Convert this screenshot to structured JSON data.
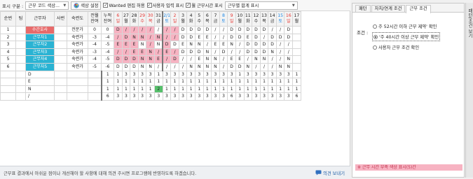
{
  "toolbar": {
    "display_label": "표시 구분 :",
    "display_value": "근무 코드 색상...",
    "color_btn": "색상 설정",
    "wanted_label": "Wanted 편집 허용",
    "user_label": "사용자 입력 표시",
    "monthly_label": "월 근무시간 표시",
    "sum_value": "근무별 합계 표시"
  },
  "grid": {
    "headers": [
      {
        "t": "순번"
      },
      {
        "t": "팀"
      },
      {
        "t": "근무자"
      },
      {
        "t": "사번"
      },
      {
        "t": "숙련도"
      },
      {
        "t": "전월 잔여"
      },
      {
        "t": "누적 잔여"
      },
      {
        "t": "6 일",
        "c": "red"
      },
      {
        "t": "27 월"
      },
      {
        "t": "28 화"
      },
      {
        "t": "29 수",
        "c": "red"
      },
      {
        "t": "30 목",
        "c": "red"
      },
      {
        "t": "31 금"
      },
      {
        "t": "2/1 토",
        "c": "blu"
      },
      {
        "t": "2 일",
        "c": "red"
      },
      {
        "t": "3 월"
      },
      {
        "t": "4 화"
      },
      {
        "t": "5 수"
      },
      {
        "t": "6 목"
      },
      {
        "t": "7 금"
      },
      {
        "t": "8 토",
        "c": "blu"
      },
      {
        "t": "9 일",
        "c": "red"
      },
      {
        "t": "10 월"
      },
      {
        "t": "11 화"
      },
      {
        "t": "12 수"
      },
      {
        "t": "13 목"
      },
      {
        "t": "14 금"
      },
      {
        "t": "15 토",
        "c": "blu"
      },
      {
        "t": "16 일",
        "c": "red"
      },
      {
        "t": "17 월"
      }
    ],
    "rows": [
      {
        "no": "1",
        "name": "수간호사",
        "nc": "red",
        "skill": "전문가",
        "prev": "0",
        "acc": "0",
        "d": [
          "D",
          "/",
          "/",
          "/",
          "/",
          "/",
          "/",
          "/",
          "D",
          "D",
          "D",
          "D",
          "/",
          "/",
          "D",
          "D",
          "D",
          "D",
          "D",
          "/",
          "/",
          "D"
        ],
        "p": [
          1,
          1,
          1,
          1,
          1,
          0,
          1,
          1
        ]
      },
      {
        "no": "2",
        "name": "근무자1",
        "nc": "blu",
        "skill": "숙련가",
        "prev": "-3",
        "acc": "-4",
        "d": [
          "/",
          "D",
          "N",
          "N",
          "/",
          "N",
          "/",
          "/",
          "D",
          "D",
          "E",
          "E",
          "/",
          "/",
          "D",
          "D",
          "E",
          "D",
          "/",
          "D",
          "D",
          "D"
        ],
        "p": [
          1,
          1,
          1,
          1,
          1,
          1,
          1,
          1
        ]
      },
      {
        "no": "3",
        "name": "근무자2",
        "nc": "blu",
        "skill": "숙련가",
        "prev": "-4",
        "acc": "-5",
        "d": [
          "E",
          "E",
          "E",
          "N",
          "/",
          "N",
          "D",
          "D",
          "E",
          "N",
          "N",
          "/",
          "E",
          "E",
          "N",
          "/",
          "D",
          "D",
          "D",
          "D",
          "/",
          "/"
        ],
        "p": [
          1,
          1,
          1,
          0,
          1,
          0,
          1,
          0
        ]
      },
      {
        "no": "4",
        "name": "근무자3",
        "nc": "blu",
        "skill": "숙련가",
        "prev": "-3",
        "acc": "-4",
        "d": [
          "/",
          "/",
          "E",
          "E",
          "N",
          "/",
          "E",
          "/",
          "D",
          "D",
          "D",
          "N",
          "/",
          "D",
          "/",
          "/",
          "D",
          "D",
          "D",
          "N",
          "/",
          "/"
        ],
        "p": [
          1,
          1,
          1,
          1,
          1,
          1,
          1,
          1
        ]
      },
      {
        "no": "5",
        "name": "근무자4",
        "nc": "blu",
        "skill": "숙련가",
        "prev": "-4",
        "acc": "-5",
        "d": [
          "D",
          "D",
          "D",
          "N",
          "N",
          "E",
          "/",
          "D",
          "/",
          "/",
          "E",
          "N",
          "N",
          "/",
          "E",
          "E",
          "/",
          "N",
          "N",
          "/",
          "/",
          "N"
        ],
        "p": [
          1,
          1,
          1,
          1,
          1,
          1,
          1,
          1
        ]
      },
      {
        "no": "6",
        "name": "근무자5",
        "nc": "blu",
        "skill": "숙련가",
        "prev": "-5",
        "acc": "-6",
        "d": [
          "D",
          "D",
          "D",
          "N",
          "N",
          "/",
          "/",
          "/",
          "/",
          "N",
          "N",
          "N",
          "N",
          "/",
          "D",
          "D",
          "N",
          "/",
          "/",
          "/",
          "N",
          "N"
        ],
        "p": [
          0,
          0,
          0,
          0,
          0,
          0,
          0,
          0
        ]
      }
    ],
    "summary": [
      {
        "code": "D",
        "v": [
          "1",
          "1",
          "3",
          "3",
          "3",
          "3",
          "1",
          "3",
          "3",
          "3",
          "3",
          "3",
          "3",
          "3",
          "3",
          "3",
          "1",
          "3",
          "3",
          "3",
          "3",
          "3",
          "3",
          "1"
        ]
      },
      {
        "code": "E",
        "v": [
          "1",
          "1",
          "1",
          "1",
          "1",
          "1",
          "1",
          "1",
          "1",
          "1",
          "1",
          "1",
          "1",
          "1",
          "1",
          "1",
          "1",
          "1",
          "1",
          "1",
          "1",
          "1",
          "1",
          "1"
        ]
      },
      {
        "code": "N",
        "v": [
          "1",
          "1",
          "1",
          "1",
          "1",
          "1",
          "2",
          "1",
          "1",
          "1",
          "1",
          "1",
          "1",
          "1",
          "1",
          "1",
          "1",
          "1",
          "1",
          "1",
          "1",
          "1",
          "1",
          "1"
        ]
      },
      {
        "code": "/",
        "v": [
          "6",
          "3",
          "3",
          "3",
          "3",
          "3",
          "3",
          "3",
          "3",
          "3",
          "3",
          "3",
          "3",
          "3",
          "3",
          "6",
          "3",
          "3",
          "3",
          "3",
          "3",
          "3",
          "3",
          "6"
        ]
      }
    ]
  },
  "statusbar": {
    "message": "근무표 결과에서 아쉬운 점이나 개선해야 할 사항에 대해 의견 주시면 프로그램에 반영하도록 하겠습니다.",
    "feedback": "의견 보내기"
  },
  "panel": {
    "tabs": [
      "패턴",
      "자치/연계 조건",
      "근무 조건"
    ],
    "active_tab": 2,
    "condition_label": "조건 :",
    "options": [
      "주 52시간 이하 근무 제약' 확인",
      "'주 40시간 이상 근무 제약' 확인",
      "사용자 근무 조건 확인"
    ],
    "selected": 1,
    "note": "※ 근무 시간 부족 색상 표시(5)간",
    "side_label": "패턴/조건 보기"
  },
  "colors": {
    "head_nurse": "#e86a6a",
    "worker": "#2ab3d3",
    "alert": "#f7b3c2",
    "ok": "#56c06b"
  }
}
